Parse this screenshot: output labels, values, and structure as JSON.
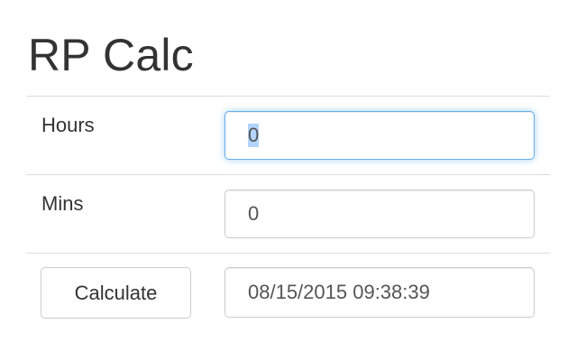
{
  "app": {
    "title": "RP Calc"
  },
  "form": {
    "hours": {
      "label": "Hours",
      "value": "0"
    },
    "mins": {
      "label": "Mins",
      "value": "0"
    },
    "calculate_label": "Calculate",
    "result": "08/15/2015 09:38:39"
  },
  "colors": {
    "focus_border": "#66afe9",
    "border": "#cccccc",
    "divider": "#dddddd",
    "text": "#333333"
  }
}
